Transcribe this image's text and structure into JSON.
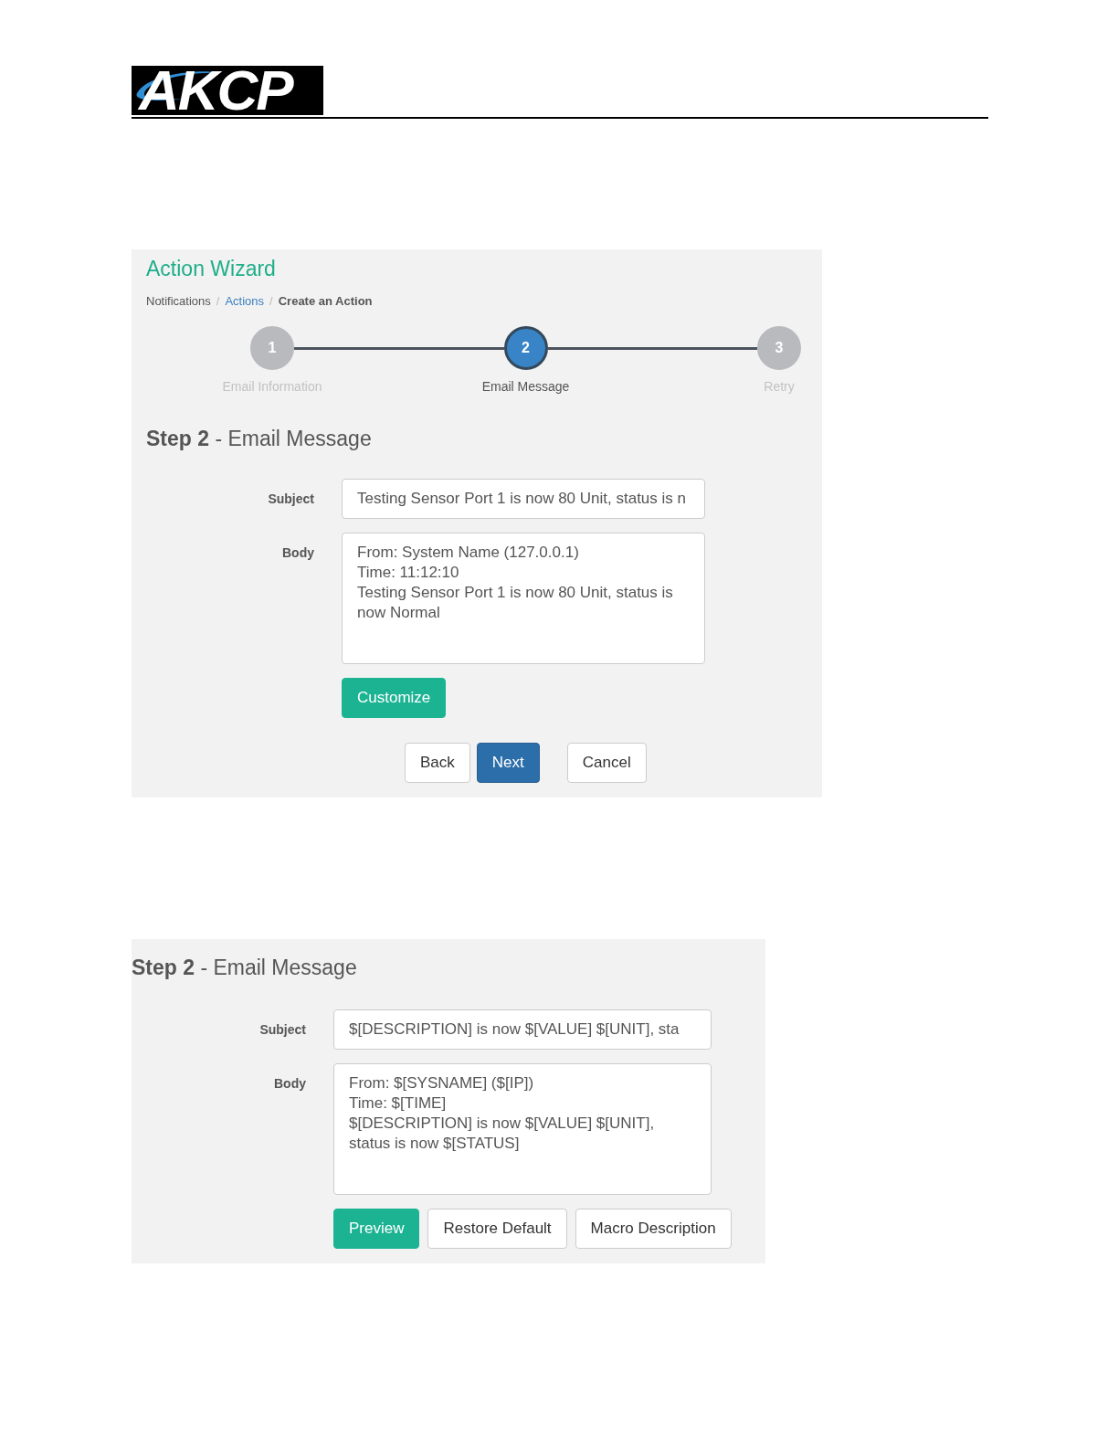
{
  "header": {
    "logo": "AKCP"
  },
  "wizard": {
    "title": "Action Wizard",
    "breadcrumb": [
      {
        "label": "Notifications",
        "kind": "text",
        "separator": "/"
      },
      {
        "label": "Actions",
        "kind": "link",
        "separator": "/"
      },
      {
        "label": "Create an Action",
        "kind": "current"
      }
    ],
    "steps": [
      {
        "number": "1",
        "label": "Email Information",
        "selected": false
      },
      {
        "number": "2",
        "label": "Email Message",
        "selected": true
      },
      {
        "number": "3",
        "label": "Retry",
        "selected": false
      }
    ],
    "heading": "**Step 2** - Email Message",
    "fields": [
      {
        "label": "Subject",
        "kind": "input",
        "value": "Testing Sensor Port 1 is now 80 Unit, status is n"
      },
      {
        "label": "Body",
        "kind": "textarea",
        "value": "From: System Name (127.0.0.1)\nTime: 11:12:10\nTesting Sensor Port 1 is now 80 Unit, status is\nnow Normal"
      }
    ],
    "actions": [
      {
        "label": "Customize",
        "kind": "primary"
      }
    ],
    "nav": {
      "left": [
        {
          "label": "Back",
          "kind": "default"
        },
        {
          "label": "Next",
          "kind": "blue"
        }
      ],
      "right": [
        {
          "label": "Cancel",
          "kind": "default"
        }
      ]
    }
  },
  "editor": {
    "heading": "**Step 2** - Email Message",
    "fields": [
      {
        "label": "Subject",
        "kind": "input",
        "value": "$[DESCRIPTION] is now $[VALUE] $[UNIT], sta"
      },
      {
        "label": "Body",
        "kind": "textarea",
        "value": "From: $[SYSNAME] ($[IP])\nTime: $[TIME]\n$[DESCRIPTION] is now $[VALUE] $[UNIT],\nstatus is now $[STATUS]"
      }
    ],
    "actions": [
      {
        "label": "Preview",
        "kind": "primary"
      },
      {
        "label": "Restore Default",
        "kind": "default"
      },
      {
        "label": "Macro Description",
        "kind": "default"
      }
    ]
  }
}
